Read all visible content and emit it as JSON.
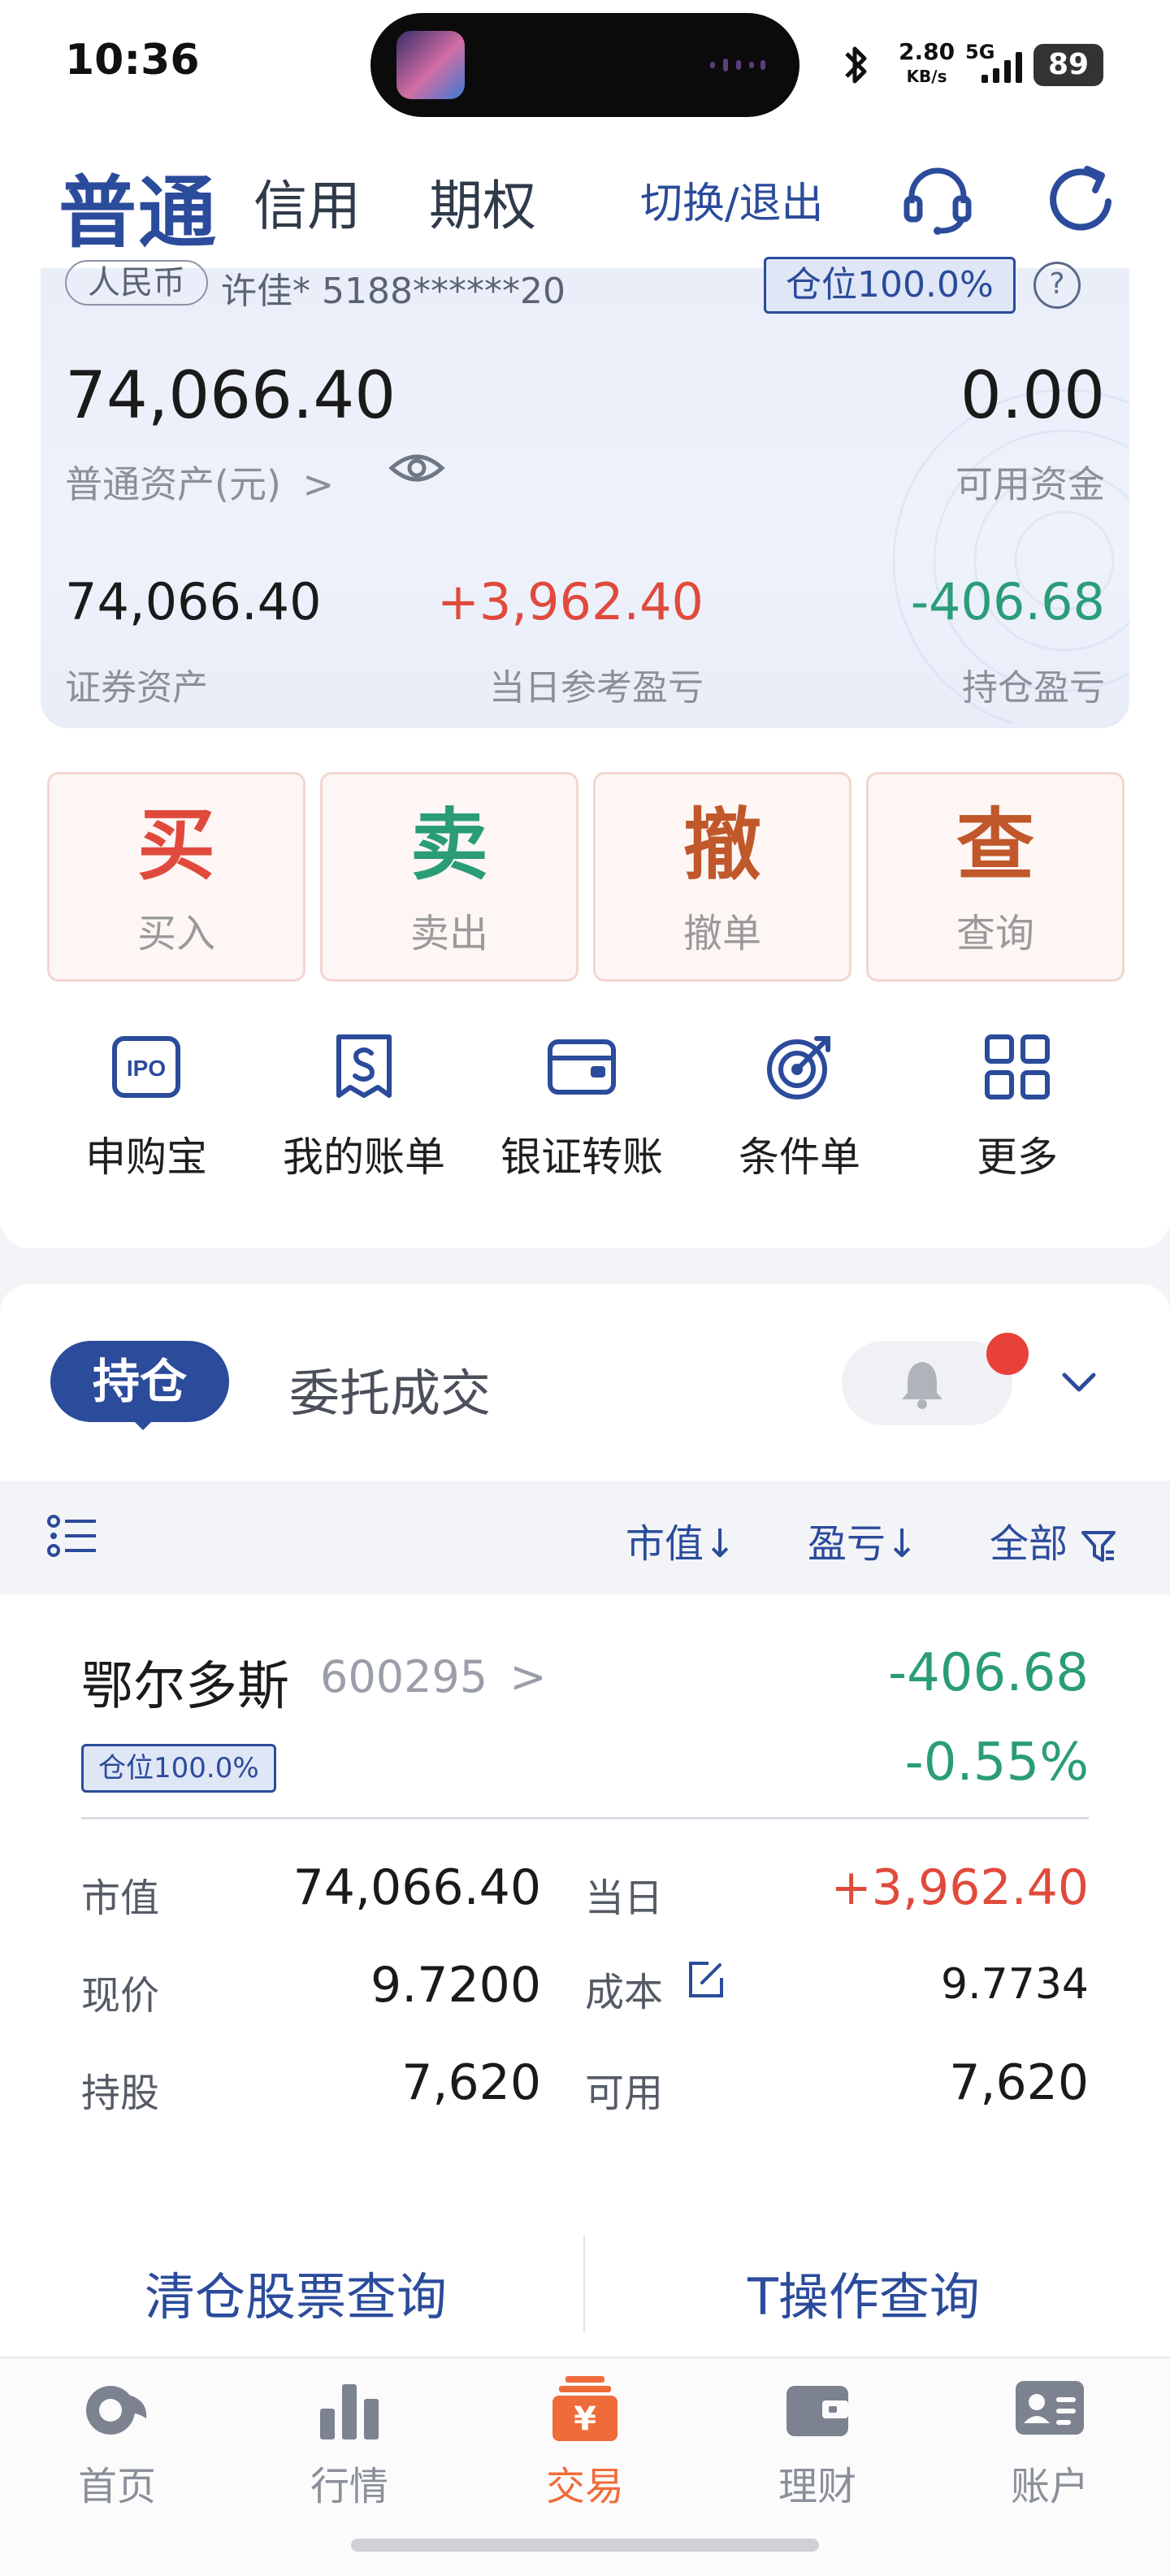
{
  "status_bar": {
    "time": "10:36",
    "net_speed": "2.80",
    "net_unit": "KB/s",
    "network": "5G",
    "battery": "89",
    "icons": [
      "bluetooth-icon",
      "signal-icon",
      "battery-icon"
    ]
  },
  "header": {
    "tabs": [
      "普通",
      "信用",
      "期权"
    ],
    "switch_label": "切换/退出",
    "icons": [
      "headset-icon",
      "refresh-icon"
    ]
  },
  "account": {
    "currency": "人民币",
    "name_masked": "许佳* 5188******20",
    "position_badge": "仓位100.0%",
    "help": "?",
    "total_assets": "74,066.40",
    "total_assets_label": "普通资产(元)",
    "total_assets_chevron": ">",
    "available_funds": "0.00",
    "available_funds_label": "可用资金",
    "securities_assets": "74,066.40",
    "securities_assets_label": "证券资产",
    "daily_pnl": "+3,962.40",
    "daily_pnl_label": "当日参考盈亏",
    "holding_pnl": "-406.68",
    "holding_pnl_label": "持仓盈亏"
  },
  "actions": [
    {
      "glyph": "买",
      "label": "买入",
      "color": "#e04a3c"
    },
    {
      "glyph": "卖",
      "label": "卖出",
      "color": "#2a9d78"
    },
    {
      "glyph": "撤",
      "label": "撤单",
      "color": "#c0582b"
    },
    {
      "glyph": "查",
      "label": "查询",
      "color": "#c0582b"
    }
  ],
  "quick_links": [
    {
      "label": "申购宝",
      "icon": "ipo-icon"
    },
    {
      "label": "我的账单",
      "icon": "bill-icon"
    },
    {
      "label": "银证转账",
      "icon": "wallet-icon"
    },
    {
      "label": "条件单",
      "icon": "target-icon"
    },
    {
      "label": "更多",
      "icon": "grid-icon"
    }
  ],
  "holdings_tabs": {
    "active": "持仓",
    "other": "委托成交"
  },
  "filters": {
    "sort_value": "市值↓",
    "sort_pnl": "盈亏↓",
    "scope": "全部"
  },
  "holding": {
    "name": "鄂尔多斯",
    "code": "600295",
    "code_chevron": ">",
    "position_badge": "仓位100.0%",
    "pnl": "-406.68",
    "pnl_pct": "-0.55%",
    "market_value_label": "市值",
    "market_value": "74,066.40",
    "daily_label": "当日",
    "daily": "+3,962.40",
    "price_label": "现价",
    "price": "9.7200",
    "cost_label": "成本",
    "cost": "9.7734",
    "shares_label": "持股",
    "shares": "7,620",
    "available_label": "可用",
    "available": "7,620"
  },
  "queries": {
    "left": "清仓股票查询",
    "right": "T操作查询"
  },
  "nav": [
    {
      "label": "首页",
      "icon": "home-icon"
    },
    {
      "label": "行情",
      "icon": "chart-icon"
    },
    {
      "label": "交易",
      "icon": "trade-icon"
    },
    {
      "label": "理财",
      "icon": "wallet-icon"
    },
    {
      "label": "账户",
      "icon": "account-icon"
    }
  ],
  "colors": {
    "brand": "#2b4b9b",
    "up": "#e04a3c",
    "down": "#2a9d78",
    "active_nav": "#ef6c3a"
  }
}
